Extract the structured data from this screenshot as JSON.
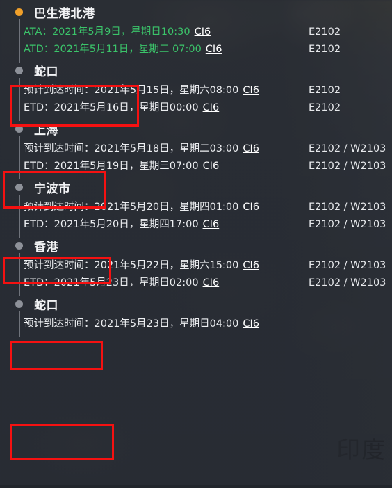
{
  "map": {
    "background_label": "印度",
    "accent_color": "#f0a02a",
    "actual_color": "#3bc46a",
    "highlight_color": "#f51111",
    "panel_bg": "#282c33"
  },
  "timeline": {
    "stops": [
      {
        "name": "巴生港北港",
        "status": "active",
        "highlighted": false,
        "rows": [
          {
            "type": "actual",
            "label": "ATA：2021年5月9日，星期日10:30",
            "link": "CI6",
            "voyage": "E2102"
          },
          {
            "type": "actual",
            "label": "ATD：2021年5月11日，星期二 07:00",
            "link": "CI6",
            "voyage": "E2102"
          }
        ]
      },
      {
        "name": "蛇口",
        "status": "pending",
        "highlighted": true,
        "rows": [
          {
            "type": "estimated",
            "label": "预计到达时间：2021年5月15日，星期六08:00",
            "link": "CI6",
            "voyage": "E2102"
          },
          {
            "type": "estimated",
            "label": "ETD：2021年5月16日，星期日00:00",
            "link": "CI6",
            "voyage": "E2102"
          }
        ]
      },
      {
        "name": "上海",
        "status": "pending",
        "highlighted": true,
        "rows": [
          {
            "type": "estimated",
            "label": "预计到达时间：2021年5月18日，星期二03:00",
            "link": "CI6",
            "voyage": "E2102 / W2103"
          },
          {
            "type": "estimated",
            "label": "ETD：2021年5月19日，星期三07:00",
            "link": "CI6",
            "voyage": "E2102 / W2103"
          }
        ]
      },
      {
        "name": "宁波市",
        "status": "pending",
        "highlighted": true,
        "rows": [
          {
            "type": "estimated",
            "label": "预计到达时间：2021年5月20日，星期四01:00",
            "link": "CI6",
            "voyage": "E2102 / W2103"
          },
          {
            "type": "estimated",
            "label": "ETD：2021年5月20日，星期四17:00",
            "link": "CI6",
            "voyage": "E2102 / W2103"
          }
        ]
      },
      {
        "name": "香港",
        "status": "pending",
        "highlighted": true,
        "rows": [
          {
            "type": "estimated",
            "label": "预计到达时间：2021年5月22日，星期六15:00",
            "link": "CI6",
            "voyage": "E2102 / W2103"
          },
          {
            "type": "estimated",
            "label": "ETD：2021年5月23日，星期日02:00",
            "link": "CI6",
            "voyage": "E2102 / W2103"
          }
        ]
      },
      {
        "name": "蛇口",
        "status": "pending",
        "highlighted": true,
        "rows": [
          {
            "type": "estimated",
            "label": "预计到达时间：2021年5月23日，星期日04:00",
            "link": "CI6",
            "voyage": ""
          }
        ]
      }
    ]
  }
}
